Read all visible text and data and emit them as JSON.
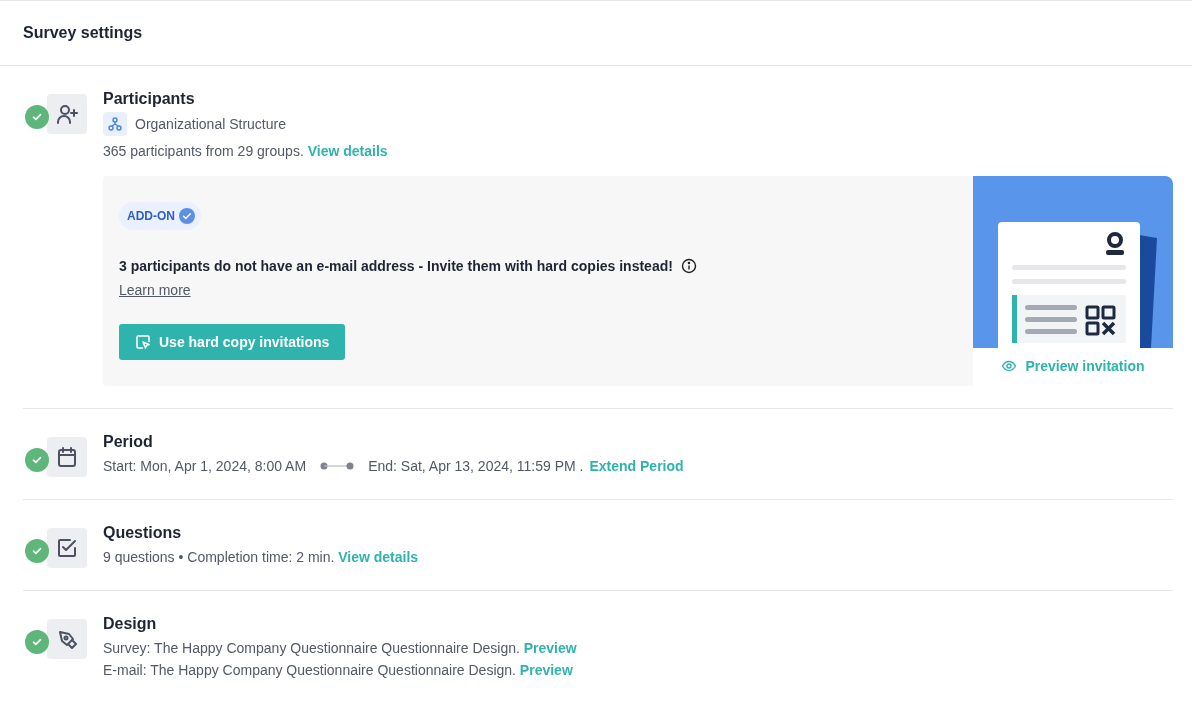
{
  "header": {
    "title": "Survey settings"
  },
  "sections": [
    {
      "kind": "participants",
      "done": true,
      "title": "Participants",
      "source": {
        "label": "Organizational Structure"
      },
      "lines": [
        {
          "kind": "text",
          "text": "365 participants from 29 groups.",
          "link": "View details"
        }
      ],
      "addon": {
        "badge": "ADD-ON",
        "message": "3 participants do not have an e-mail address - Invite them with hard copies instead!",
        "learn_more": "Learn more",
        "button": "Use hard copy invitations",
        "preview": "Preview invitation"
      }
    },
    {
      "kind": "period",
      "done": true,
      "title": "Period",
      "lines": [
        {
          "kind": "range",
          "start": "Start: Mon, Apr 1, 2024, 8:00 AM",
          "end": "End: Sat, Apr 13, 2024, 11:59 PM .",
          "link": "Extend Period"
        }
      ]
    },
    {
      "kind": "questions",
      "done": true,
      "title": "Questions",
      "lines": [
        {
          "kind": "text",
          "text": "9 questions • Completion time: 2 min.",
          "link": "View details"
        }
      ]
    },
    {
      "kind": "design",
      "done": true,
      "title": "Design",
      "lines": [
        {
          "kind": "text",
          "text": "Survey: The Happy Company Questionnaire Questionnaire Design.",
          "link": "Preview"
        },
        {
          "kind": "text",
          "text": "E-mail: The Happy Company Questionnaire Questionnaire Design.",
          "link": "Preview"
        }
      ]
    }
  ]
}
